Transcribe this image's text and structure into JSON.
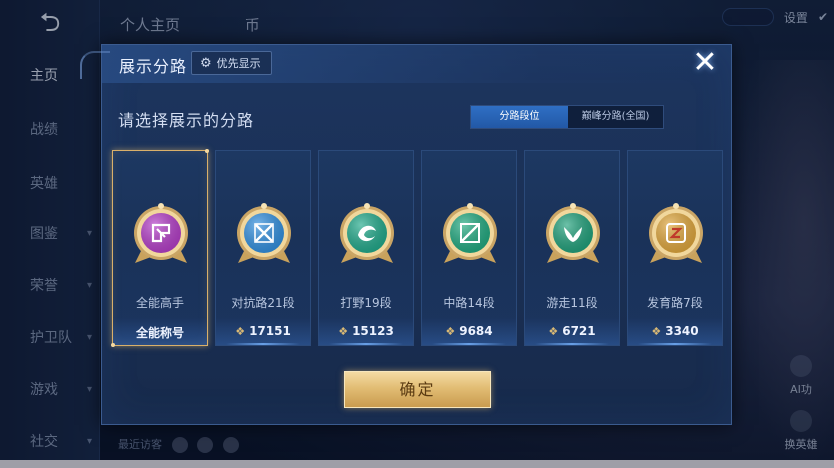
{
  "background": {
    "back_icon": "back-arrow-icon",
    "top_tabs": [
      "个人主页",
      "币"
    ],
    "nav_items": [
      {
        "label": "主页",
        "active": true,
        "chevron": false
      },
      {
        "label": "战绩",
        "active": false,
        "chevron": false
      },
      {
        "label": "英雄",
        "active": false,
        "chevron": false
      },
      {
        "label": "图鉴",
        "active": false,
        "chevron": true
      },
      {
        "label": "荣誉",
        "active": false,
        "chevron": true
      },
      {
        "label": "护卫队",
        "active": false,
        "chevron": true
      },
      {
        "label": "游戏",
        "active": false,
        "chevron": true
      },
      {
        "label": "社交",
        "active": false,
        "chevron": true
      }
    ],
    "top_right_label": "设置",
    "side_buttons": [
      "AI功",
      "换英雄"
    ],
    "bottom_hint": "最近访客"
  },
  "modal": {
    "title": "展示分路",
    "priority_button": {
      "icon": "gear-icon",
      "label": "优先显示"
    },
    "close_icon": "close-x-icon",
    "subtitle": "请选择展示的分路",
    "toggle": {
      "selected": "分路段位",
      "other": "巅峰分路(全国)"
    },
    "cards": [
      {
        "label": "全能高手",
        "value": "全能称号",
        "badge_color": "#b43cc8",
        "badge": "all-round-badge-icon",
        "selected": true,
        "show_points": false
      },
      {
        "label": "对抗路21段",
        "value": "17151",
        "badge_color": "#2f8fe0",
        "badge": "clash-lane-badge-icon",
        "selected": false,
        "show_points": true
      },
      {
        "label": "打野19段",
        "value": "15123",
        "badge_color": "#1fa98a",
        "badge": "jungle-badge-icon",
        "selected": false,
        "show_points": true
      },
      {
        "label": "中路14段",
        "value": "9684",
        "badge_color": "#1ea97f",
        "badge": "mid-lane-badge-icon",
        "selected": false,
        "show_points": true
      },
      {
        "label": "游走11段",
        "value": "6721",
        "badge_color": "#1ea07a",
        "badge": "roam-badge-icon",
        "selected": false,
        "show_points": true
      },
      {
        "label": "发育路7段",
        "value": "3340",
        "badge_color": "#e0a63a",
        "badge": "farm-lane-badge-icon",
        "selected": false,
        "show_points": true
      }
    ],
    "points_icon": "points-icon",
    "confirm_label": "确定"
  },
  "colors": {
    "accent_gold": "#e2bd74",
    "toggle_blue": "#2f6fc4",
    "panel_bg": "#1b3157"
  }
}
